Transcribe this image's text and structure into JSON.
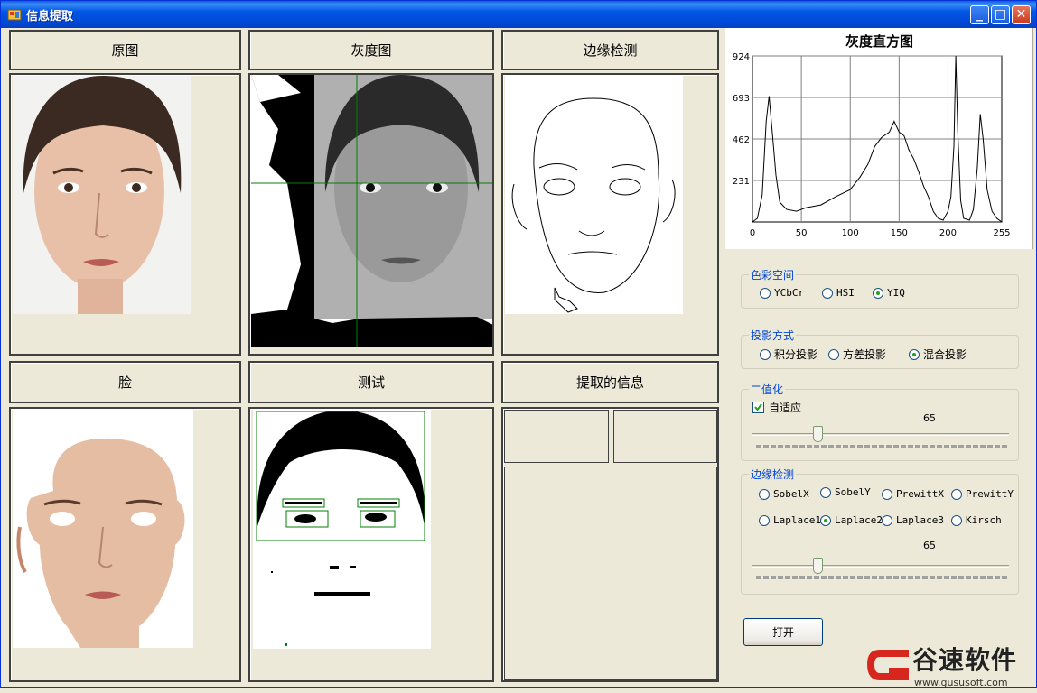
{
  "window": {
    "title": "信息提取"
  },
  "titlebar_buttons": {
    "minimize": "_",
    "maximize": "□",
    "close": "✕"
  },
  "panels": {
    "original": {
      "title": "原图"
    },
    "gray": {
      "title": "灰度图"
    },
    "edge": {
      "title": "边缘检测"
    },
    "face": {
      "title": "脸"
    },
    "test": {
      "title": "测试"
    },
    "extracted": {
      "title": "提取的信息"
    }
  },
  "histogram": {
    "title": "灰度直方图",
    "y_ticks": [
      "924",
      "693",
      "462",
      "231"
    ],
    "x_ticks": [
      "0",
      "50",
      "100",
      "150",
      "200",
      "255"
    ]
  },
  "chart_data": {
    "type": "line",
    "title": "灰度直方图",
    "xlim": [
      0,
      255
    ],
    "ylim": [
      0,
      924
    ],
    "y_ticks": [
      231,
      462,
      693,
      924
    ],
    "x_ticks": [
      0,
      50,
      100,
      150,
      200,
      255
    ],
    "grid": true,
    "x": [
      0,
      5,
      10,
      14,
      17,
      20,
      24,
      28,
      35,
      45,
      55,
      70,
      85,
      100,
      110,
      118,
      125,
      132,
      140,
      145,
      150,
      155,
      160,
      165,
      170,
      175,
      180,
      185,
      190,
      195,
      200,
      203,
      206,
      208,
      210,
      213,
      216,
      222,
      226,
      230,
      233,
      236,
      240,
      245,
      250,
      255
    ],
    "y": [
      0,
      20,
      150,
      560,
      700,
      520,
      260,
      110,
      70,
      60,
      80,
      95,
      140,
      180,
      250,
      320,
      420,
      470,
      500,
      560,
      500,
      480,
      400,
      350,
      280,
      200,
      140,
      60,
      20,
      10,
      60,
      140,
      420,
      924,
      500,
      120,
      20,
      10,
      70,
      300,
      600,
      460,
      180,
      60,
      20,
      0
    ]
  },
  "color_space": {
    "title": "色彩空间",
    "options": [
      {
        "label": "YCbCr",
        "checked": false
      },
      {
        "label": "HSI",
        "checked": false
      },
      {
        "label": "YIQ",
        "checked": true
      }
    ]
  },
  "projection": {
    "title": "投影方式",
    "options": [
      {
        "label": "积分投影",
        "checked": false
      },
      {
        "label": "方差投影",
        "checked": false
      },
      {
        "label": "混合投影",
        "checked": true
      }
    ]
  },
  "binarize": {
    "title": "二值化",
    "adaptive_label": "自适应",
    "adaptive_checked": true,
    "slider_value": "65",
    "slider_fraction": 0.255
  },
  "edge_detect": {
    "title": "边缘检测",
    "options": [
      {
        "label": "SobelX",
        "checked": false
      },
      {
        "label": "SobelY",
        "checked": false
      },
      {
        "label": "PrewittX",
        "checked": false
      },
      {
        "label": "PrewittY",
        "checked": false
      },
      {
        "label": "Laplace1",
        "checked": false
      },
      {
        "label": "Laplace2",
        "checked": true
      },
      {
        "label": "Laplace3",
        "checked": false
      },
      {
        "label": "Kirsch",
        "checked": false
      }
    ],
    "slider_value": "65",
    "slider_fraction": 0.255
  },
  "open_button": {
    "label": "打开"
  },
  "watermark": {
    "brand": "谷速软件",
    "url": "www.gususoft.com"
  }
}
